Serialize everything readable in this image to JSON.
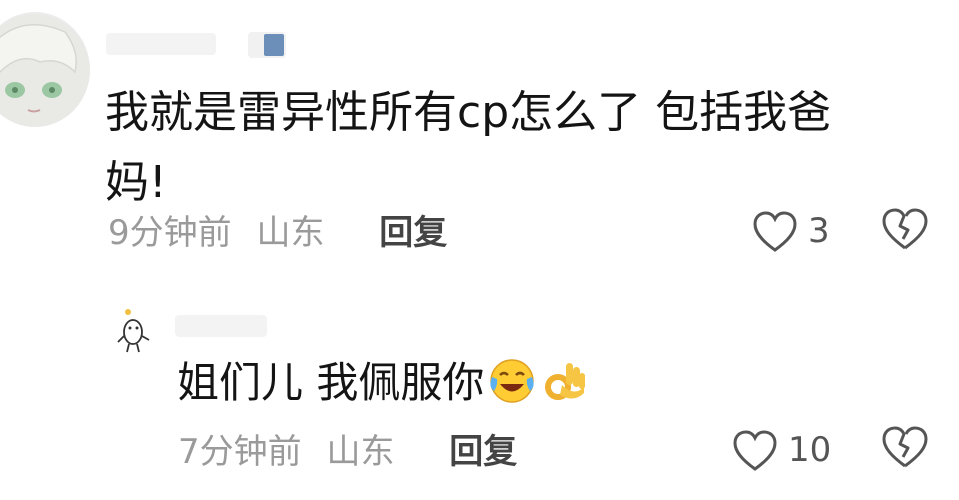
{
  "comments": [
    {
      "text_line1": "我就是雷异性所有cp怎么了 包括我爸",
      "text_line2": "妈!",
      "time": "9分钟前",
      "location": "山东",
      "reply_label": "回复",
      "likes": "3"
    },
    {
      "text": "姐们儿 我佩服你",
      "emojis": [
        "laughing-crying-emoji",
        "ok-hand-emoji"
      ],
      "time": "7分钟前",
      "location": "山东",
      "reply_label": "回复",
      "likes": "10"
    }
  ],
  "colors": {
    "text": "#141414",
    "meta": "#9a9a9a",
    "icon": "#555555",
    "badge": "#6b8fb8"
  }
}
